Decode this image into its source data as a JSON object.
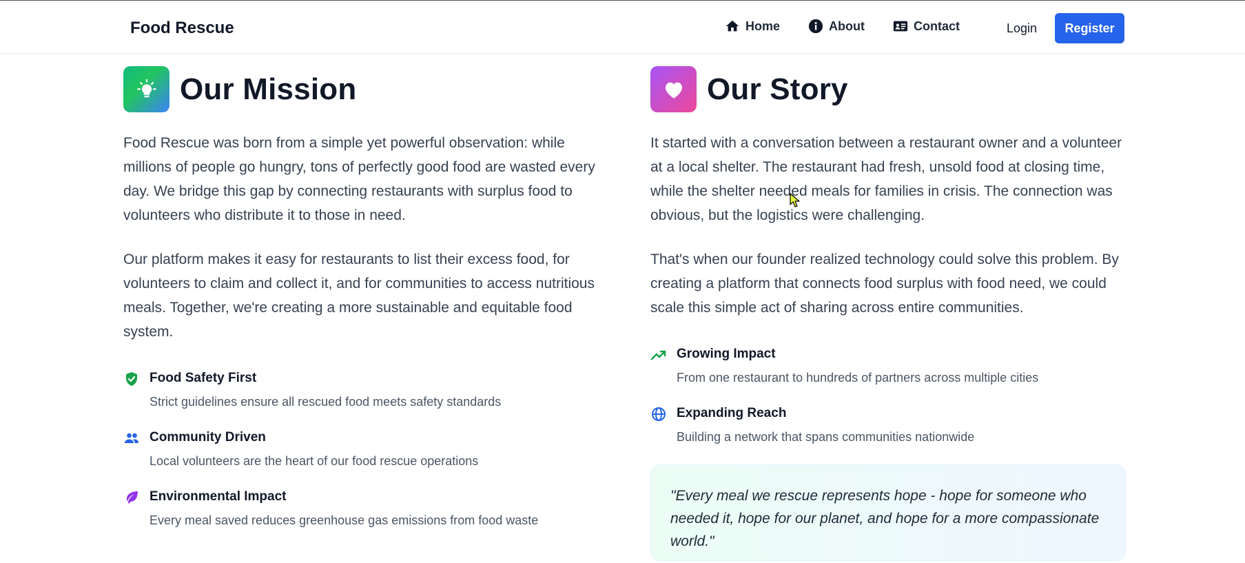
{
  "nav": {
    "brand": "Food Rescue",
    "home": "Home",
    "about": "About",
    "contact": "Contact",
    "login": "Login",
    "register": "Register",
    "accent": "#2563eb"
  },
  "mission": {
    "title": "Our Mission",
    "icon": "lightbulb-icon",
    "paragraphs": [
      "Food Rescue was born from a simple yet powerful observation: while millions of people go hungry, tons of perfectly good food are wasted every day. We bridge this gap by connecting restaurants with surplus food to volunteers who distribute it to those in need.",
      "Our platform makes it easy for restaurants to list their excess food, for volunteers to claim and collect it, and for communities to access nutritious meals. Together, we're creating a more sustainable and equitable food system."
    ],
    "features": [
      {
        "title": "Food Safety First",
        "desc": "Strict guidelines ensure all rescued food meets safety standards",
        "icon": "shield-check-icon",
        "color": "#16a34a"
      },
      {
        "title": "Community Driven",
        "desc": "Local volunteers are the heart of our food rescue operations",
        "icon": "users-icon",
        "color": "#2563eb"
      },
      {
        "title": "Environmental Impact",
        "desc": "Every meal saved reduces greenhouse gas emissions from food waste",
        "icon": "leaf-icon",
        "color": "#9333ea"
      }
    ]
  },
  "story": {
    "title": "Our Story",
    "icon": "heart-icon",
    "paragraphs": [
      "It started with a conversation between a restaurant owner and a volunteer at a local shelter. The restaurant had fresh, unsold food at closing time, while the shelter needed meals for families in crisis. The connection was obvious, but the logistics were challenging.",
      "That's when our founder realized technology could solve this problem. By creating a platform that connects food surplus with food need, we could scale this simple act of sharing across entire communities."
    ],
    "features": [
      {
        "title": "Growing Impact",
        "desc": "From one restaurant to hundreds of partners across multiple cities",
        "icon": "trending-up-icon",
        "color": "#16a34a"
      },
      {
        "title": "Expanding Reach",
        "desc": "Building a network that spans communities nationwide",
        "icon": "globe-icon",
        "color": "#2563eb"
      }
    ],
    "quote": "\"Every meal we rescue represents hope - hope for someone who needed it, hope for our planet, and hope for a more compassionate world.\""
  }
}
